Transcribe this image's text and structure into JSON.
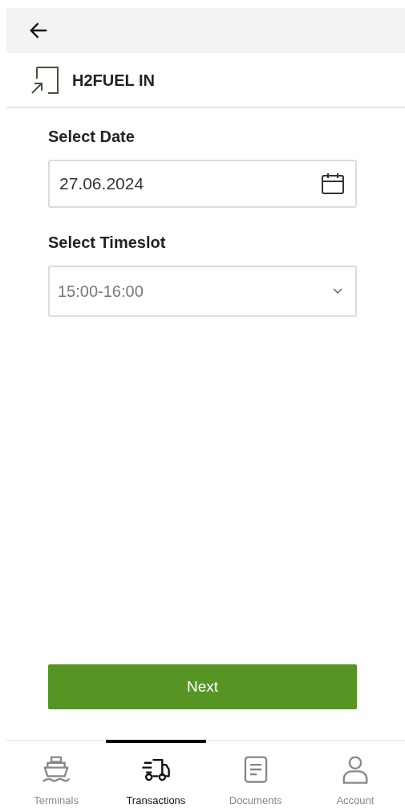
{
  "header": {
    "title": "H2FUEL IN"
  },
  "date": {
    "label": "Select Date",
    "value": "27.06.2024"
  },
  "timeslot": {
    "label": "Select Timeslot",
    "value": "15:00-16:00"
  },
  "next_button": "Next",
  "nav": [
    {
      "kind": "ship",
      "label": "Terminals",
      "selected": false
    },
    {
      "kind": "truck",
      "label": "Transactions",
      "selected": true
    },
    {
      "kind": "document",
      "label": "Documents",
      "selected": false
    },
    {
      "kind": "person",
      "label": "Account",
      "selected": false
    }
  ]
}
